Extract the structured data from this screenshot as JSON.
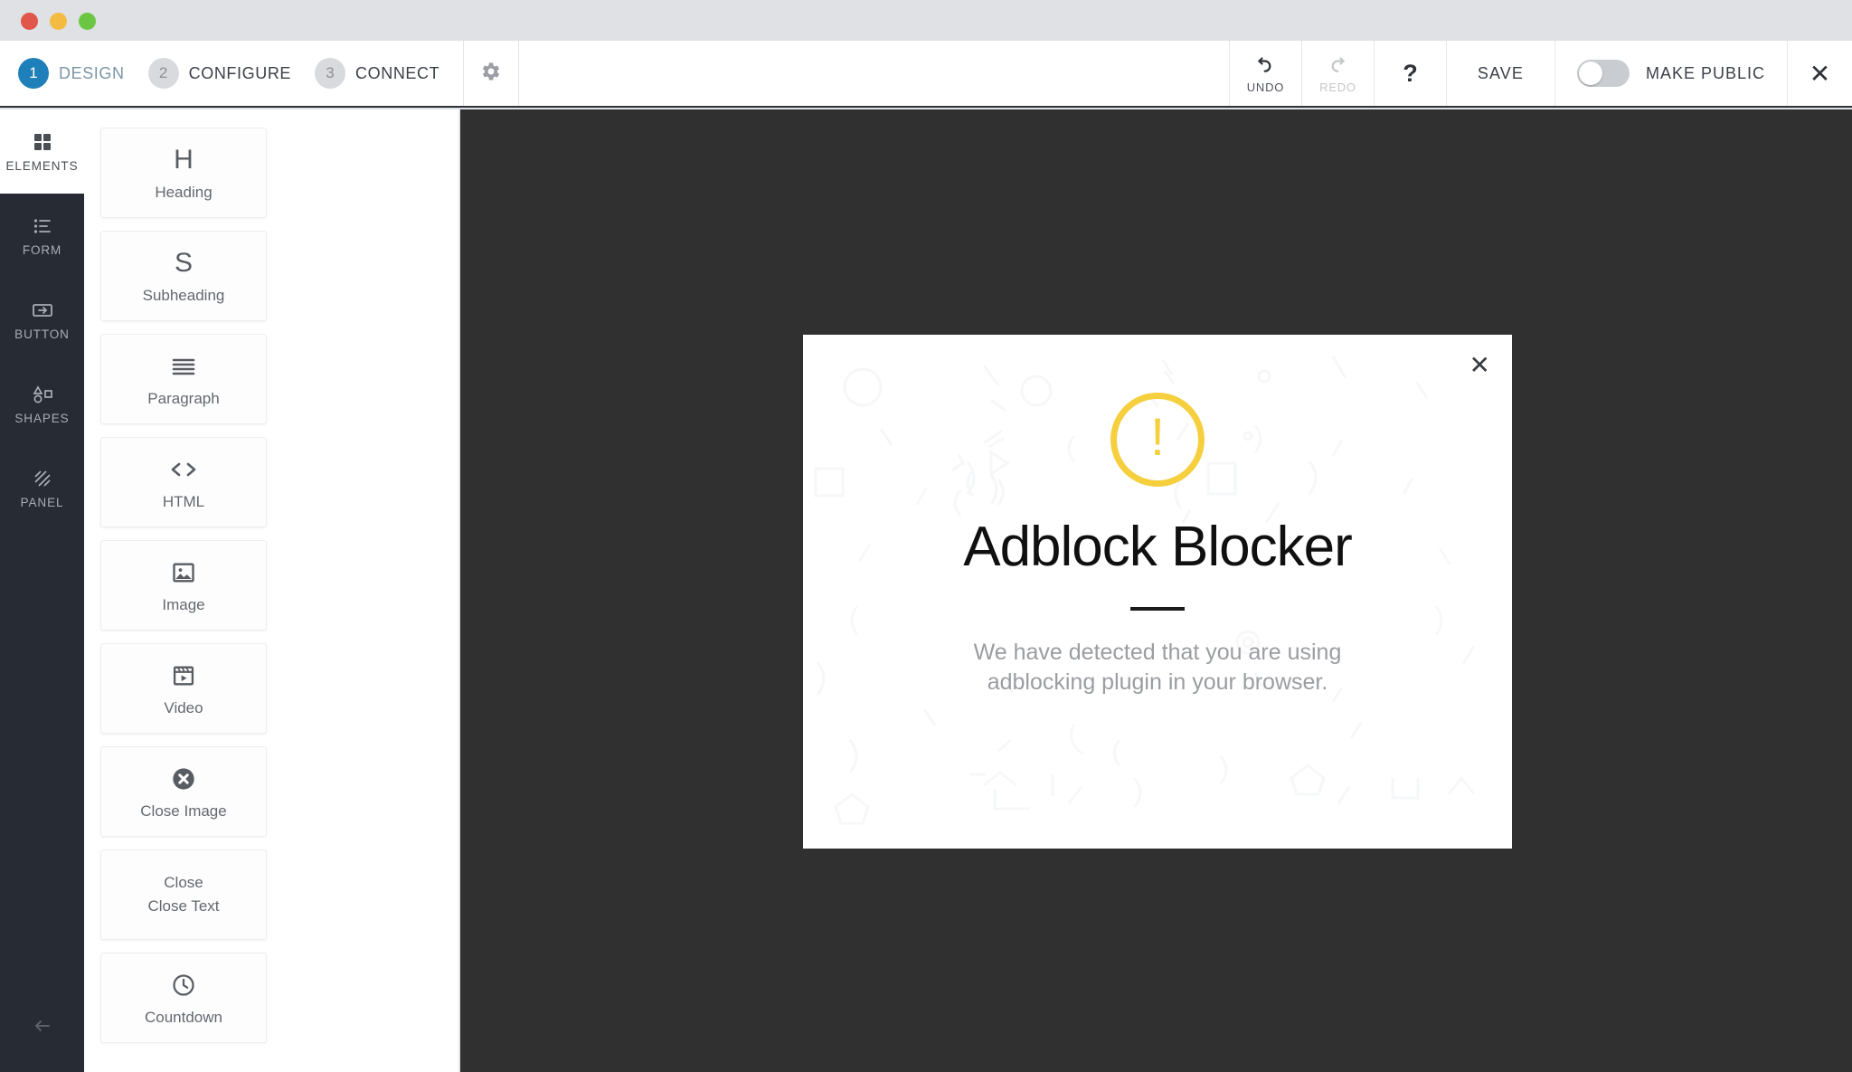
{
  "window": {
    "traffic_lights": [
      {
        "name": "close",
        "color": "#e0564a"
      },
      {
        "name": "minimize",
        "color": "#f3bb42"
      },
      {
        "name": "zoom",
        "color": "#6cc644"
      }
    ]
  },
  "toolbar": {
    "steps": [
      {
        "number": "1",
        "label": "DESIGN",
        "active": true
      },
      {
        "number": "2",
        "label": "CONFIGURE",
        "active": false
      },
      {
        "number": "3",
        "label": "CONNECT",
        "active": false
      }
    ],
    "settings_icon": "gear-icon",
    "undo": {
      "label": "UNDO",
      "icon": "undo-arrow-icon",
      "disabled": false
    },
    "redo": {
      "label": "REDO",
      "icon": "redo-arrow-icon",
      "disabled": true
    },
    "help": {
      "label": "?",
      "icon": "question-mark-icon"
    },
    "save": {
      "label": "SAVE"
    },
    "make_public": {
      "label": "MAKE PUBLIC",
      "enabled": false
    },
    "close": {
      "label": "✕",
      "icon": "close-icon"
    }
  },
  "sidebar": {
    "items": [
      {
        "label": "ELEMENTS",
        "icon": "grid-squares-icon",
        "active": true
      },
      {
        "label": "FORM",
        "icon": "form-list-icon",
        "active": false
      },
      {
        "label": "BUTTON",
        "icon": "button-arrow-icon",
        "active": false
      },
      {
        "label": "SHAPES",
        "icon": "shapes-icon",
        "active": false
      },
      {
        "label": "PANEL",
        "icon": "hatched-panel-icon",
        "active": false
      }
    ],
    "back": {
      "icon": "arrow-left-icon"
    }
  },
  "elements_panel": {
    "cards": [
      {
        "title": "Heading",
        "sub": "",
        "icon": "letter-h-icon"
      },
      {
        "title": "Subheading",
        "sub": "",
        "icon": "letter-s-icon"
      },
      {
        "title": "Paragraph",
        "sub": "",
        "icon": "paragraph-lines-icon"
      },
      {
        "title": "HTML",
        "sub": "",
        "icon": "code-brackets-icon"
      },
      {
        "title": "Image",
        "sub": "",
        "icon": "image-picture-icon"
      },
      {
        "title": "Video",
        "sub": "",
        "icon": "video-clapper-icon"
      },
      {
        "title": "Close Image",
        "sub": "",
        "icon": "close-circle-icon"
      },
      {
        "title": "Close",
        "sub": "Close Text",
        "icon": ""
      },
      {
        "title": "Countdown",
        "sub": "",
        "icon": "clock-icon"
      }
    ]
  },
  "canvas": {
    "background_color": "#303030",
    "modal": {
      "close_label": "✕",
      "warning_icon": "exclamation-circle-icon",
      "warning_color": "#f5cf3d",
      "title": "Adblock Blocker",
      "subtitle_line1": "We have detected that you are using",
      "subtitle_line2": "adblocking plugin in your browser.",
      "settings_icon": "gear-icon"
    }
  }
}
